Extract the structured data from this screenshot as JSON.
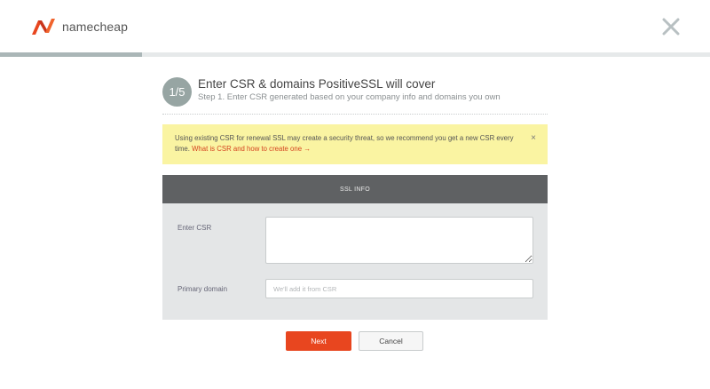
{
  "header": {
    "brand": "namecheap",
    "brand_color": "#de3723",
    "close_icon": "close-icon",
    "progress": 0.2
  },
  "step": {
    "counter": "1/5",
    "title": "Enter CSR & domains PositiveSSL will cover",
    "subtitle": "Step 1. Enter CSR generated based on your company info and domains you own"
  },
  "alert": {
    "message": "Using existing CSR for renewal SSL may create a security threat, so we recommend you get a new CSR every time.",
    "link_text": "What is CSR and how to create one →",
    "close_symbol": "×",
    "background": "#faf4a2"
  },
  "panel": {
    "heading": "SSL INFO",
    "csr_label": "Enter CSR",
    "csr_value": "",
    "domain_label": "Primary domain",
    "domain_placeholder": "We'll add it from CSR"
  },
  "actions": {
    "next_label": "Next",
    "cancel_label": "Cancel",
    "accent": "#e8461f"
  }
}
